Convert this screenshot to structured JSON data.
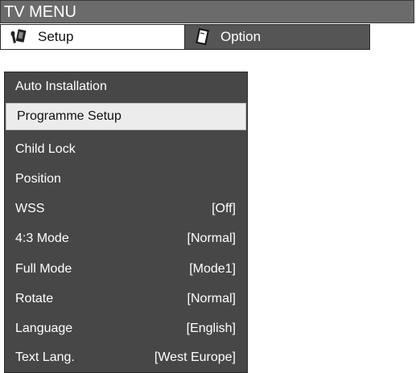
{
  "title": "TV MENU",
  "tabs": [
    {
      "label": "Setup",
      "icon": "setup-tool-icon",
      "active": true
    },
    {
      "label": "Option",
      "icon": "option-card-icon",
      "active": false
    }
  ],
  "menu": {
    "items": [
      {
        "label": "Auto Installation",
        "value": ""
      },
      {
        "label": "Programme Setup",
        "value": "",
        "selected": true
      },
      {
        "label": "Child Lock",
        "value": ""
      },
      {
        "label": "Position",
        "value": ""
      },
      {
        "label": "WSS",
        "value": "[Off]"
      },
      {
        "label": "4:3 Mode",
        "value": "[Normal]"
      },
      {
        "label": "Full Mode",
        "value": "[Mode1]"
      },
      {
        "label": "Rotate",
        "value": "[Normal]"
      },
      {
        "label": "Language",
        "value": "[English]"
      },
      {
        "label": "Text Lang.",
        "value": "[West Europe]"
      }
    ]
  },
  "colors": {
    "title_bar": "#6b6b6b",
    "panel": "#474747",
    "selected_row": "#ececec",
    "option_tab": "#555555"
  }
}
